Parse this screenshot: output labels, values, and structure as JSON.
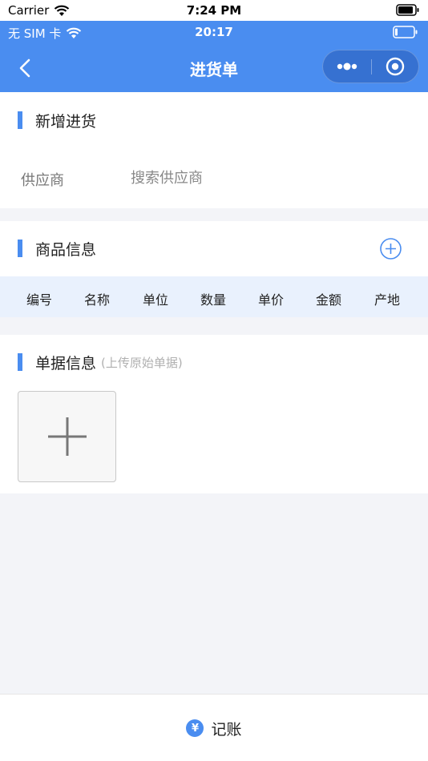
{
  "device_status": {
    "carrier": "Carrier",
    "time": "7:24 PM"
  },
  "app_status": {
    "carrier": "无 SIM 卡",
    "time": "20:17"
  },
  "navbar": {
    "title": "进货单"
  },
  "section_new": {
    "title": "新增进货",
    "supplier_label": "供应商",
    "supplier_placeholder": "搜索供应商",
    "supplier_value": ""
  },
  "section_goods": {
    "title": "商品信息",
    "columns": [
      "编号",
      "名称",
      "单位",
      "数量",
      "单价",
      "金额",
      "产地"
    ]
  },
  "section_docs": {
    "title": "单据信息",
    "hint": "(上传原始单据)"
  },
  "bottom": {
    "coin_symbol": "¥",
    "account_label": "记账"
  },
  "colors": {
    "primary": "#4a8df0",
    "header_bg": "#e9f1fd",
    "page_bg": "#f3f4f8"
  },
  "icons": [
    "wifi-icon",
    "battery-icon",
    "back-chevron-icon",
    "more-dots-icon",
    "target-icon",
    "plus-circle-icon",
    "plus-icon",
    "yuan-coin-icon"
  ]
}
